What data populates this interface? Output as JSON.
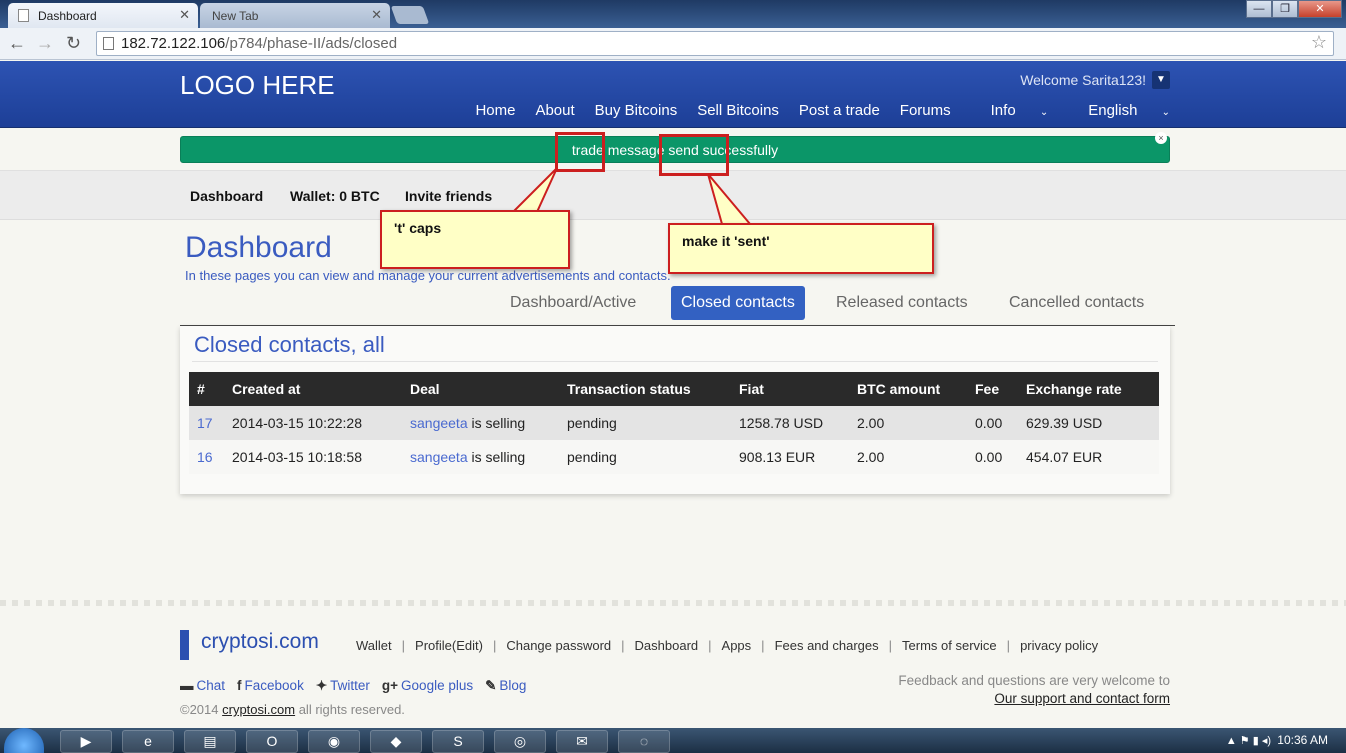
{
  "browser": {
    "tabs": [
      {
        "label": "Dashboard"
      },
      {
        "label": "New Tab"
      }
    ],
    "url_host": "182.72.122.106",
    "url_path": "/p784/phase-II/ads/closed"
  },
  "header": {
    "logo": "LOGO HERE",
    "welcome": "Welcome Sarita123!",
    "nav": [
      "Home",
      "About",
      "Buy Bitcoins",
      "Sell Bitcoins",
      "Post a trade",
      "Forums",
      "Info",
      "English"
    ]
  },
  "alert": {
    "message": "trade message send successfully",
    "close": "×"
  },
  "subnav": {
    "dashboard": "Dashboard",
    "wallet": "Wallet: 0 BTC",
    "invite": "Invite friends"
  },
  "page": {
    "title": "Dashboard",
    "subtitle": "In these pages you can view and manage your current advertisements and contacts."
  },
  "contact_tabs": [
    {
      "label": "Dashboard/Active"
    },
    {
      "label": "Closed contacts"
    },
    {
      "label": "Released contacts"
    },
    {
      "label": "Cancelled contacts"
    }
  ],
  "panel": {
    "title": "Closed contacts, all",
    "columns": [
      "#",
      "Created at",
      "Deal",
      "Transaction status",
      "Fiat",
      "BTC amount",
      "Fee",
      "Exchange rate"
    ],
    "rows": [
      {
        "id": "17",
        "created": "2014-03-15 10:22:28",
        "user": "sangeeta",
        "deal_suffix": " is selling",
        "status": "pending",
        "fiat": "1258.78 USD",
        "btc": "2.00",
        "fee": "0.00",
        "rate": "629.39 USD"
      },
      {
        "id": "16",
        "created": "2014-03-15 10:18:58",
        "user": "sangeeta",
        "deal_suffix": " is selling",
        "status": "pending",
        "fiat": "908.13 EUR",
        "btc": "2.00",
        "fee": "0.00",
        "rate": "454.07 EUR"
      }
    ]
  },
  "annotations": {
    "t_caps": "'t' caps",
    "make_sent": "make it 'sent'",
    "color": "#cc1f1f"
  },
  "footer": {
    "brand": "cryptosi.com",
    "links": [
      "Wallet",
      "Profile(Edit)",
      "Change password",
      "Dashboard",
      "Apps",
      "Fees and charges",
      "Terms of service",
      "privacy policy"
    ],
    "social": [
      {
        "icon": "chat-icon",
        "glyph": "▬",
        "label": "Chat"
      },
      {
        "icon": "facebook-icon",
        "glyph": "f",
        "label": "Facebook"
      },
      {
        "icon": "twitter-icon",
        "glyph": "✦",
        "label": "Twitter"
      },
      {
        "icon": "google-plus-icon",
        "glyph": "g+",
        "label": "Google plus"
      },
      {
        "icon": "blog-icon",
        "glyph": "✎",
        "label": "Blog"
      }
    ],
    "copyright_prefix": "©2014 ",
    "copyright_link": "cryptosi.com",
    "copyright_suffix": " all rights reserved.",
    "feedback_text": "Feedback and questions are very welcome to",
    "feedback_link": "Our support and contact form"
  },
  "taskbar": {
    "clock": "10:36 AM"
  }
}
